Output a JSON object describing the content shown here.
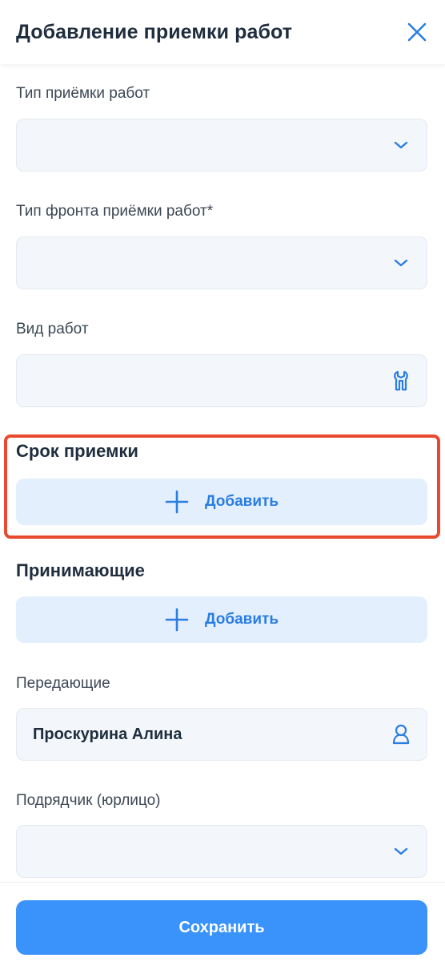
{
  "header": {
    "title": "Добавление приемки работ",
    "close_icon": "close-icon"
  },
  "form": {
    "acceptance_type": {
      "label": "Тип приёмки работ",
      "value": "",
      "icon": "chevron-down-icon"
    },
    "front_type": {
      "label": "Тип фронта приёмки работ*",
      "value": "",
      "icon": "chevron-down-icon"
    },
    "work_kind": {
      "label": "Вид работ",
      "value": "",
      "icon": "wrench-icon"
    },
    "deadline": {
      "title": "Срок приемки",
      "add_label": "Добавить",
      "icon": "plus-icon"
    },
    "receivers": {
      "title": "Принимающие",
      "add_label": "Добавить",
      "icon": "plus-icon"
    },
    "transferring": {
      "label": "Передающие",
      "value": "Проскурина Алина",
      "icon": "user-icon"
    },
    "contractor": {
      "label": "Подрядчик (юрлицо)",
      "value": "",
      "icon": "chevron-down-icon"
    }
  },
  "footer": {
    "save_label": "Сохранить"
  },
  "colors": {
    "accent": "#3a92fb",
    "add_bg": "#e4effd",
    "highlight": "#e8492f",
    "input_bg": "#f3f7fb"
  }
}
